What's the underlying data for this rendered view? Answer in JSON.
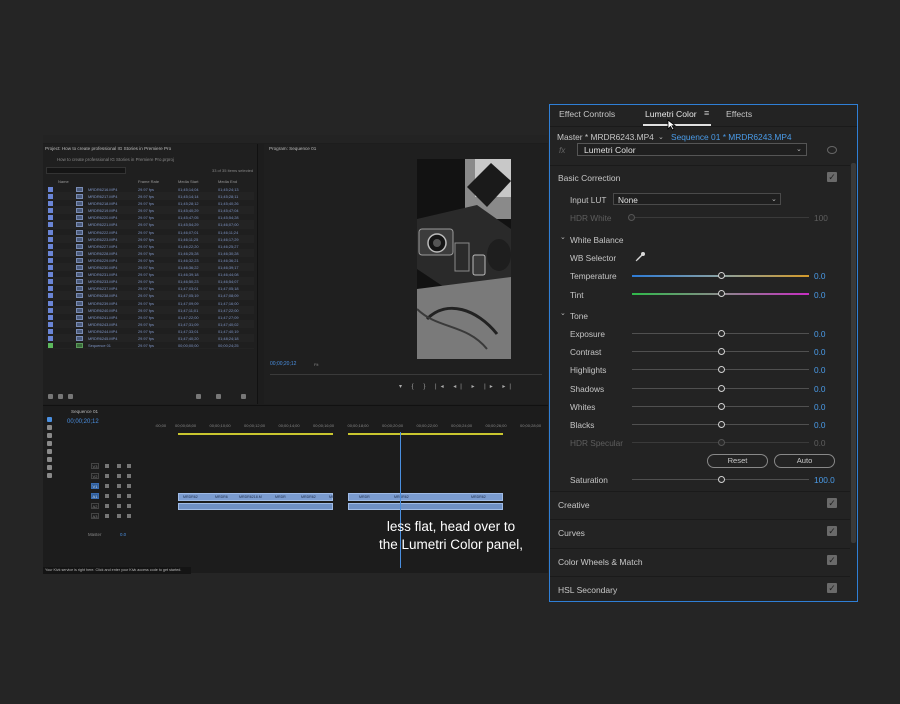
{
  "premiere": {
    "project_panel_title": "Project: How to create professional IG Stories in Premiere Pro",
    "project_path": "How to create professional IG Stories in Premiere Pro.prproj",
    "items_selected": "33 of 35 items selected",
    "columns": [
      "Name",
      "Frame Rate",
      "Media Start",
      "Media End"
    ],
    "rows": [
      [
        "MRDR6216.MP4",
        "29.97 fps",
        "01;45;14;04",
        "01;45;24;13"
      ],
      [
        "MRDR6217.MP4",
        "29.97 fps",
        "01;45;14;14",
        "01;45;28;11"
      ],
      [
        "MRDR6218.MP4",
        "29.97 fps",
        "01;45;28;12",
        "01;45;40;26"
      ],
      [
        "MRDR6219.MP4",
        "29.97 fps",
        "01;45;40;29",
        "01;45;47;04"
      ],
      [
        "MRDR6220.MP4",
        "29.97 fps",
        "01;45;47;05",
        "01;45;54;28"
      ],
      [
        "MRDR6221.MP4",
        "29.97 fps",
        "01;45;54;29",
        "01;46;07;00"
      ],
      [
        "MRDR6222.MP4",
        "29.97 fps",
        "01;46;07;01",
        "01;46;11;24"
      ],
      [
        "MRDR6223.MP4",
        "29.97 fps",
        "01;46;11;25",
        "01;46;17;29"
      ],
      [
        "MRDR6227.MP4",
        "29.97 fps",
        "01;46;22;20",
        "01;46;25;27"
      ],
      [
        "MRDR6228.MP4",
        "29.97 fps",
        "01;46;25;28",
        "01;46;30;28"
      ],
      [
        "MRDR6229.MP4",
        "29.97 fps",
        "01;46;32;23",
        "01;46;36;21"
      ],
      [
        "MRDR6230.MP4",
        "29.97 fps",
        "01;46;36;22",
        "01;46;39;17"
      ],
      [
        "MRDR6231.MP4",
        "29.97 fps",
        "01;46;39;18",
        "01;46;44;08"
      ],
      [
        "MRDR6233.MP4",
        "29.97 fps",
        "01;46;50;23",
        "01;46;54;07"
      ],
      [
        "MRDR6237.MP4",
        "29.97 fps",
        "01;47;03;01",
        "01;47;05;18"
      ],
      [
        "MRDR6238.MP4",
        "29.97 fps",
        "01;47;05;19",
        "01;47;08;09"
      ],
      [
        "MRDR6239.MP4",
        "29.97 fps",
        "01;47;09;09",
        "01;47;16;00"
      ],
      [
        "MRDR6240.MP4",
        "29.97 fps",
        "01;47;11;01",
        "01;47;22;00"
      ],
      [
        "MRDR6241.MP4",
        "29.97 fps",
        "01;47;22;00",
        "01;47;27;09"
      ],
      [
        "MRDR6243.MP4",
        "29.97 fps",
        "01;47;31;09",
        "01;47;40;02"
      ],
      [
        "MRDR6244.MP4",
        "29.97 fps",
        "01;47;33;01",
        "01;47;40;19"
      ],
      [
        "MRDR6245.MP4",
        "29.97 fps",
        "01;47;40;20",
        "01;48;24;18"
      ],
      [
        "Sequence 01",
        "29.97 fps",
        "00;00;00;00",
        "00;00;24;25"
      ]
    ],
    "program_title": "Program: Sequence 01",
    "program_timecode": "00;00;20;12",
    "program_fit": "Fit",
    "timeline_title": "Sequence 01",
    "timeline_timecode": "00;00;20;12",
    "ruler_ticks": [
      ":00;00",
      "00;00;08;00",
      "00;00;10;00",
      "00;00;12;00",
      "00;00;14;00",
      "00;00;16;00",
      "00;00;18;00",
      "00;00;20;00",
      "00;00;22;00",
      "00;00;24;00",
      "00;00;26;00",
      "00;00;28;00"
    ],
    "tracks": [
      "V3",
      "V2",
      "V1",
      "A1",
      "A2",
      "A3"
    ],
    "master_label": "Master",
    "master_value": "0.0",
    "clip_labels": [
      "MRDR62",
      "MRDR6",
      "MRDR6218.M",
      "MRDR",
      "MRDR62",
      "MR",
      "MRDR",
      "MRDR62",
      "MRDR62"
    ],
    "keyboard_tip": "Your Kivk service is right here. Click and enter your Kivk access code to get started."
  },
  "subtitle": {
    "line1": "less flat, head over to",
    "line2": "the Lumetri Color panel,"
  },
  "lumetri": {
    "tabs": {
      "effect_controls": "Effect Controls",
      "lumetri_color": "Lumetri Color",
      "effects": "Effects"
    },
    "master_clip": "Master * MRDR6243.MP4",
    "sequence_clip": "Sequence 01 * MRDR6243.MP4",
    "fx_symbol": "fx",
    "effect_name": "Lumetri Color",
    "basic_correction": {
      "title": "Basic Correction",
      "input_lut_label": "Input LUT",
      "input_lut_value": "None",
      "hdr_white_label": "HDR White",
      "hdr_white_value": "100",
      "white_balance": {
        "title": "White Balance",
        "wb_selector": "WB Selector",
        "temperature_label": "Temperature",
        "temperature_value": "0.0",
        "tint_label": "Tint",
        "tint_value": "0.0"
      },
      "tone": {
        "title": "Tone",
        "sliders": [
          {
            "label": "Exposure",
            "value": "0.0"
          },
          {
            "label": "Contrast",
            "value": "0.0"
          },
          {
            "label": "Highlights",
            "value": "0.0"
          },
          {
            "label": "Shadows",
            "value": "0.0"
          },
          {
            "label": "Whites",
            "value": "0.0"
          },
          {
            "label": "Blacks",
            "value": "0.0"
          },
          {
            "label": "HDR Specular",
            "value": "0.0"
          }
        ]
      },
      "reset_label": "Reset",
      "auto_label": "Auto",
      "saturation_label": "Saturation",
      "saturation_value": "100.0"
    },
    "sections": {
      "creative": "Creative",
      "curves": "Curves",
      "color_wheels": "Color Wheels & Match",
      "hsl_secondary": "HSL Secondary"
    }
  }
}
